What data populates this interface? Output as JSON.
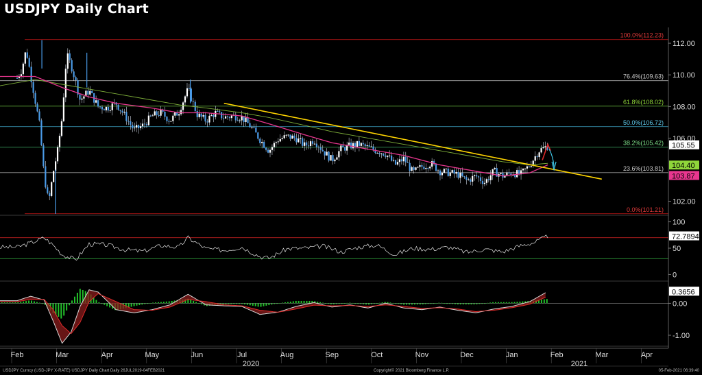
{
  "title": "USDJPY Daily Chart",
  "colors": {
    "background": "#000000",
    "candle": "#4a9be8",
    "trendline": "#ffd400",
    "ma_fast": "#e8368f",
    "ma_slow": "#7fb03a",
    "rsi_line": "#e6e6e6",
    "macd_hist": "#23c12a",
    "fib_outer": "#d01818"
  },
  "chart_data": [
    {
      "type": "line",
      "panel": "price",
      "ylim": [
        101.2,
        113.0
      ],
      "y_ticks": [
        "112.00",
        "110.00",
        "108.00",
        "106.00",
        "102.00"
      ],
      "y_tick_values": [
        112,
        110,
        108,
        106,
        102
      ],
      "x_ticks": [
        "Feb",
        "Mar",
        "Apr",
        "May",
        "Jun",
        "Jul",
        "Aug",
        "Sep",
        "Oct",
        "Nov",
        "Dec",
        "Jan",
        "Feb",
        "Mar",
        "Apr"
      ],
      "x_year_labels": [
        "2020",
        "2021"
      ],
      "fibonacci": [
        {
          "label": "100.0%(112.23)",
          "value": 112.23
        },
        {
          "label": "76.4%(109.63)",
          "value": 109.63
        },
        {
          "label": "61.8%(108.02)",
          "value": 108.02
        },
        {
          "label": "50.0%(106.72)",
          "value": 106.72
        },
        {
          "label": "38.2%(105.42)",
          "value": 105.42
        },
        {
          "label": "23.6%(103.81)",
          "value": 103.81
        },
        {
          "label": "0.0%(101.21)",
          "value": 101.21
        }
      ],
      "price_tags": [
        {
          "label": "105.55",
          "value": 105.55,
          "color": "#ffffff"
        },
        {
          "label": "104.40",
          "value": 104.4,
          "color": "#8fd63a"
        },
        {
          "label": "103.87",
          "value": 103.87,
          "color": "#e8368f"
        }
      ],
      "close_series": {
        "x_month": [
          0.0,
          0.1,
          0.2,
          0.3,
          0.4,
          0.5,
          0.6,
          0.7,
          0.8,
          0.9,
          1.0,
          1.1,
          1.2,
          1.3,
          1.4,
          1.6,
          1.8,
          2.0,
          2.2,
          2.4,
          2.6,
          2.8,
          3.0,
          3.2,
          3.4,
          3.6,
          3.8,
          4.0,
          4.2,
          4.4,
          4.6,
          4.8,
          5.0,
          5.2,
          5.4,
          5.6,
          5.8,
          6.0,
          6.2,
          6.4,
          6.6,
          6.8,
          7.0,
          7.2,
          7.4,
          7.6,
          7.8,
          8.0,
          8.2,
          8.4,
          8.6,
          8.8,
          9.0,
          9.2,
          9.4,
          9.6,
          9.8,
          10.0,
          10.2,
          10.4,
          10.6,
          10.8,
          11.0,
          11.2,
          11.4,
          11.6,
          11.8
        ],
        "y": [
          109.8,
          110.3,
          111.6,
          110.0,
          108.4,
          106.8,
          103.6,
          101.9,
          103.8,
          105.2,
          107.3,
          111.3,
          110.6,
          109.6,
          108.4,
          109.0,
          108.0,
          107.9,
          108.2,
          107.4,
          106.5,
          106.8,
          107.4,
          107.6,
          107.1,
          107.7,
          109.1,
          107.5,
          107.1,
          107.6,
          107.3,
          107.4,
          107.3,
          106.7,
          105.9,
          105.2,
          105.9,
          106.1,
          106.0,
          105.5,
          105.9,
          105.2,
          104.6,
          105.3,
          105.5,
          105.6,
          105.4,
          105.2,
          105.0,
          104.3,
          104.7,
          103.8,
          104.2,
          104.4,
          103.9,
          103.8,
          103.7,
          103.3,
          103.6,
          103.2,
          103.9,
          103.6,
          103.8,
          103.7,
          104.3,
          105.2,
          105.5
        ]
      },
      "ma_fast": {
        "x_month": [
          -0.4,
          0.4,
          1.0,
          1.6,
          2.2,
          3.0,
          3.6,
          4.2,
          5.0,
          5.6,
          6.4,
          7.0,
          7.8,
          8.6,
          9.4,
          10.2,
          10.8,
          11.4,
          11.8
        ],
        "y": [
          109.9,
          109.9,
          109.2,
          108.6,
          108.2,
          107.9,
          107.6,
          107.6,
          107.4,
          106.9,
          106.2,
          105.7,
          105.3,
          104.9,
          104.3,
          103.9,
          103.6,
          103.8,
          104.3
        ]
      },
      "ma_slow": {
        "x_month": [
          -0.4,
          0.4,
          1.0,
          1.6,
          2.2,
          3.0,
          3.6,
          4.2,
          5.0,
          5.6,
          6.4,
          7.0,
          7.8,
          8.6,
          9.4,
          10.2,
          10.8,
          11.4,
          11.8
        ],
        "y": [
          109.3,
          109.7,
          109.4,
          109.1,
          108.8,
          108.4,
          108.1,
          107.9,
          107.6,
          107.3,
          106.8,
          106.4,
          106.0,
          105.6,
          105.2,
          104.8,
          104.5,
          104.3,
          104.4
        ]
      },
      "trendline": {
        "x_month": [
          4.6,
          13.0
        ],
        "y": [
          108.2,
          103.4
        ]
      }
    },
    {
      "type": "line",
      "panel": "rsi",
      "ylim": [
        -10,
        110
      ],
      "y_ticks": [
        "100",
        "50",
        "0"
      ],
      "y_tick_values": [
        100,
        50,
        0
      ],
      "last_value_label": "72.7894",
      "last_value": 72.79,
      "levels": [
        70,
        30
      ],
      "x_month": [
        0.0,
        0.3,
        0.6,
        0.8,
        1.0,
        1.3,
        1.6,
        2.0,
        2.4,
        2.8,
        3.2,
        3.6,
        3.8,
        4.2,
        4.6,
        5.0,
        5.4,
        5.6,
        6.0,
        6.4,
        6.8,
        7.2,
        7.6,
        8.0,
        8.4,
        8.8,
        9.2,
        9.6,
        10.0,
        10.4,
        10.8,
        11.2,
        11.5,
        11.8
      ],
      "y": [
        52,
        60,
        70,
        56,
        38,
        28,
        58,
        56,
        47,
        44,
        55,
        52,
        70,
        49,
        46,
        52,
        34,
        31,
        49,
        50,
        54,
        43,
        52,
        56,
        38,
        50,
        48,
        52,
        42,
        48,
        43,
        55,
        61,
        73
      ]
    },
    {
      "type": "area",
      "panel": "macd",
      "ylim": [
        -1.3,
        0.65
      ],
      "y_ticks": [
        "0.00",
        "-1.00"
      ],
      "y_tick_values": [
        0,
        -1.0
      ],
      "last_value_label": "0.3656",
      "last_value": 0.3656,
      "x_month": [
        0.0,
        0.3,
        0.6,
        0.8,
        1.0,
        1.2,
        1.4,
        1.6,
        1.8,
        2.2,
        2.6,
        3.0,
        3.4,
        3.8,
        4.2,
        4.6,
        5.0,
        5.4,
        5.8,
        6.2,
        6.6,
        7.0,
        7.4,
        7.8,
        8.2,
        8.6,
        9.0,
        9.4,
        9.8,
        10.2,
        10.6,
        11.0,
        11.4,
        11.8
      ],
      "macd": [
        0.08,
        0.22,
        0.1,
        -0.55,
        -1.25,
        -0.9,
        -0.1,
        0.42,
        0.35,
        -0.2,
        -0.3,
        -0.2,
        -0.05,
        0.28,
        -0.05,
        -0.08,
        -0.1,
        -0.35,
        -0.28,
        -0.1,
        0.02,
        -0.12,
        -0.05,
        -0.15,
        0.0,
        -0.15,
        -0.2,
        -0.12,
        -0.22,
        -0.3,
        -0.18,
        -0.1,
        0.05,
        0.37
      ],
      "signal": [
        0.05,
        0.12,
        0.12,
        -0.2,
        -0.7,
        -0.95,
        -0.6,
        0.05,
        0.3,
        0.05,
        -0.2,
        -0.22,
        -0.12,
        0.12,
        0.05,
        -0.05,
        -0.08,
        -0.22,
        -0.28,
        -0.18,
        -0.06,
        -0.08,
        -0.07,
        -0.1,
        -0.05,
        -0.1,
        -0.16,
        -0.14,
        -0.18,
        -0.26,
        -0.22,
        -0.14,
        -0.03,
        0.22
      ]
    }
  ],
  "footer": {
    "left": "USDJPY Curncy (USD-JPY X-RATE) USDJPY Daily Chart  Daily 26JUL2019-04FEB2021",
    "center": "Copyright© 2021 Bloomberg Finance L.P.",
    "right": "05-Feb-2021 06:39:40"
  }
}
